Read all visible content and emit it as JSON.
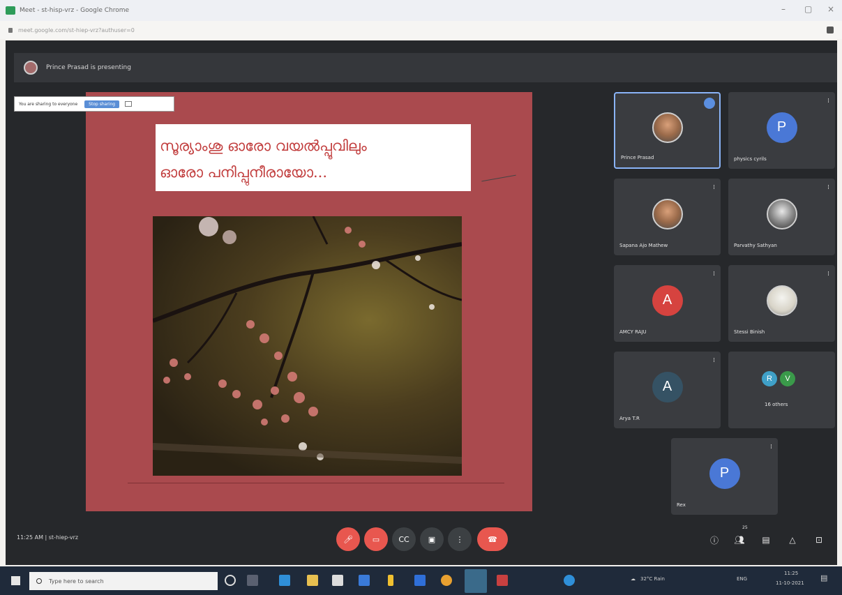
{
  "browser": {
    "title": "Meet - st-hisp-vrz - Google Chrome",
    "url": "meet.google.com/st-hiep-vrz?authuser=0",
    "controls": {
      "minimize": "–",
      "maximize": "▢",
      "close": "×"
    }
  },
  "meet": {
    "presenting_text": "Prince Prasad is presenting",
    "share_chip": {
      "text": "You are sharing to everyone",
      "stop_label": "Stop sharing"
    },
    "slide": {
      "line1": "സൂര്യാംശു ഓരോ വയൽപ്പൂവിലും",
      "line2": "ഓരോ പനിപ്പുനീരായോ..."
    },
    "participants": [
      {
        "name": "Prince Prasad",
        "avatar_type": "photo",
        "active": true,
        "mic_icon": "more-icon"
      },
      {
        "name": "physics cyrils",
        "avatar_letter": "P",
        "avatar_color": "#4a78d6",
        "mic_icon": "mic-off-icon"
      },
      {
        "name": "Sapana Ajo Mathew",
        "avatar_type": "photo",
        "mic_icon": "mic-off-icon"
      },
      {
        "name": "Parvathy Sathyan",
        "avatar_type": "photo",
        "mic_icon": "mic-off-icon"
      },
      {
        "name": "AMCY RAJU",
        "avatar_letter": "A",
        "avatar_color": "#d6433f",
        "mic_icon": "mic-off-icon"
      },
      {
        "name": "Stessi Binish",
        "avatar_type": "photo",
        "mic_icon": "mic-off-icon"
      },
      {
        "name": "Arya T.R",
        "avatar_letter": "A",
        "avatar_color": "#355264",
        "mic_icon": "mic-off-icon"
      },
      {
        "name": "16 others",
        "others": true,
        "letters": [
          "R",
          "V"
        ],
        "colors": [
          "#3fa0c8",
          "#3a9a4a"
        ]
      },
      {
        "name": "Rex",
        "avatar_letter": "P",
        "avatar_color": "#4a78d6",
        "mic_icon": "mic-off-icon"
      }
    ],
    "meeting_info": "11:25 AM | st-hiep-vrz",
    "controls": [
      "mic-off-icon",
      "camera-off-icon",
      "captions-icon",
      "present-icon",
      "more-icon",
      "end-call-icon"
    ],
    "right_controls": [
      "info-icon",
      "people-icon",
      "chat-icon",
      "activities-icon",
      "lock-icon"
    ],
    "people_count": "25"
  },
  "taskbar": {
    "search_placeholder": "Type here to search",
    "weather": "32°C Rain",
    "time": "11:25",
    "date": "11-10-2021",
    "language": "ENG"
  }
}
